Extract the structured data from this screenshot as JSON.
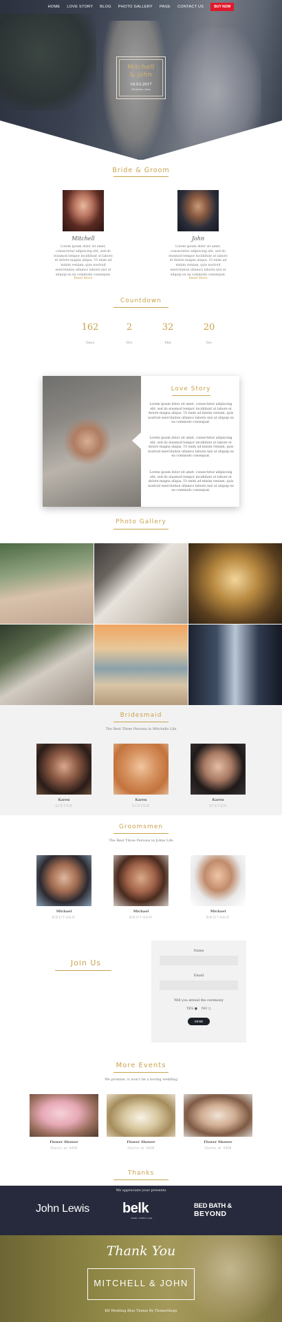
{
  "nav": {
    "items": [
      "HOME",
      "LOVE STORY",
      "BLOG",
      "PHOTO GALLERY",
      "PAGE",
      "CONTACT US"
    ],
    "buy": "BUY NOW"
  },
  "hero": {
    "names_line1": "Mitchell",
    "names_line2": "& John",
    "date": "16.03.2017",
    "place": "Mumbai, Asia"
  },
  "bride_groom": {
    "title": "Bride & Groom",
    "bride": {
      "name": "Mitchell",
      "bio": "Lorem ipsum dolor sit amet, consectetur adipiscing elit, sed do eiusmod tempor incididunt ut labore et dolore magna aliqua. Ut enim ad minim veniam, quis nostrud exercitation ullamco laboris nisi ut aliquip ex ea commodo consequat.",
      "read_more": "Read More"
    },
    "groom": {
      "name": "John",
      "bio": "Lorem ipsum dolor sit amet, consectetur adipiscing elit, sed do eiusmod tempor incididunt ut labore et dolore magna aliqua. Ut enim ad minim veniam, quis nostrud exercitation ullamco laboris nisi ut aliquip ex ea commodo consequat.",
      "read_more": "Read More"
    }
  },
  "countdown": {
    "title": "Countdown",
    "items": [
      {
        "value": "162",
        "label": "Days"
      },
      {
        "value": "2",
        "label": "Hrs"
      },
      {
        "value": "32",
        "label": "Min"
      },
      {
        "value": "20",
        "label": "Sec"
      }
    ]
  },
  "love_story": {
    "title": "Love Story",
    "paragraphs": [
      "Lorem ipsum dolor sit amet, consectetur adipiscing elit, sed do eiusmod tempor incididunt ut labore et dolore magna aliqua. Ut enim ad minim veniam, quis nostrud exercitation ullamco laboris nisi ut aliquip ex ea commodo consequat.",
      "Lorem ipsum dolor sit amet, consectetur adipiscing elit, sed do eiusmod tempor incididunt ut labore et dolore magna aliqua. Ut enim ad minim veniam, quis nostrud exercitation ullamco laboris nisi ut aliquip ex ea commodo consequat.",
      "Lorem ipsum dolor sit amet, consectetur adipiscing elit, sed do eiusmod tempor incididunt ut labore et dolore magna aliqua. Ut enim ad minim veniam, quis nostrud exercitation ullamco laboris nisi ut aliquip ex ea commodo consequat."
    ]
  },
  "gallery": {
    "title": "Photo Gallery"
  },
  "bridesmaid": {
    "title": "Bridesmaid",
    "subtitle": "The Best Three Persons in Mitchells Life",
    "members": [
      {
        "name": "Karen",
        "role": "SISTER"
      },
      {
        "name": "Karen",
        "role": "SISTER"
      },
      {
        "name": "Karen",
        "role": "SISTER"
      }
    ]
  },
  "groomsmen": {
    "title": "Groomsmen",
    "subtitle": "The Best Three Persons in Johns Life",
    "members": [
      {
        "name": "Michael",
        "role": "BROTHER"
      },
      {
        "name": "Michael",
        "role": "BROTHER"
      },
      {
        "name": "Michael",
        "role": "BROTHER"
      }
    ]
  },
  "join": {
    "title": "Join Us",
    "name_label": "Name",
    "email_label": "Email",
    "question": "Will you attend the ceremony",
    "yes": "YES",
    "no": "NO",
    "send": "SEND"
  },
  "events": {
    "title": "More Events",
    "subtitle": "We promise, it won't be a boring wedding",
    "items": [
      {
        "name": "Flower Shower",
        "time": "Starts at 4AM"
      },
      {
        "name": "Flower Shower",
        "time": "Starts at 4AM"
      },
      {
        "name": "Flower Shower",
        "time": "Starts at 4AM"
      }
    ]
  },
  "thanks": {
    "title": "Thanks",
    "subtitle": "We appreciate your presents",
    "sponsors": {
      "john_lewis": "John Lewis",
      "belk": "belk",
      "belk_sub": "modern. southern. style.",
      "bbb_line1": "BED BATH &",
      "bbb_line2": "BEYOND"
    }
  },
  "footer": {
    "thank_you": "Thank You",
    "names": "MITCHELL & JOHN",
    "credit": "KR Wedding Blue Theme By ThemeShopy"
  },
  "colors": {
    "accent": "#c8a24a",
    "buy": "#e0192b",
    "sponsor_band": "#272a3c",
    "footer": "#8e8644"
  }
}
